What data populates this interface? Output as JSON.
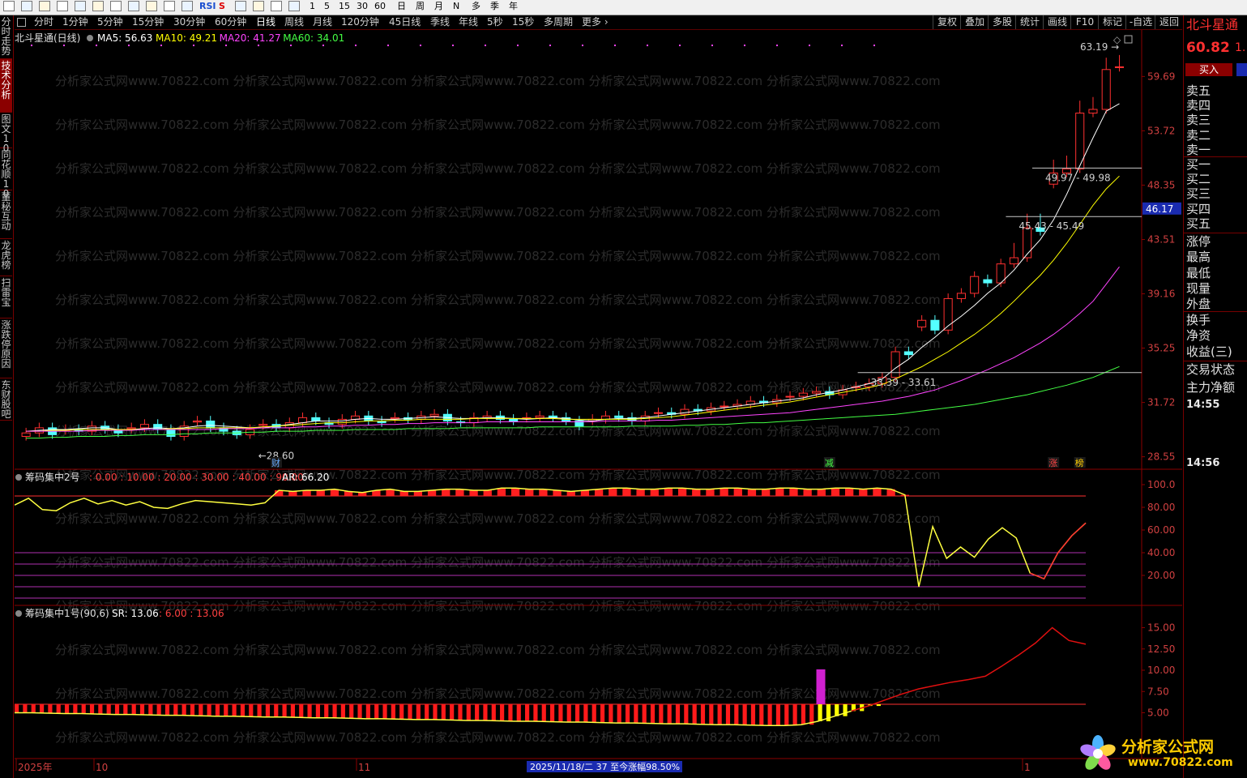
{
  "toolbar": {
    "icon_names": [
      "back-icon",
      "up-arrow-icon",
      "refresh-icon",
      "chart-icon",
      "table-icon",
      "line-chart-icon",
      "bar-chart-icon",
      "f10-icon",
      "f2-icon",
      "f3-icon",
      "circle-icon",
      "rsi-icon",
      "s-icon",
      "move-icon",
      "pen-icon",
      "f5-icon",
      "refresh2-icon"
    ],
    "rsi": "RSI",
    "s": "S",
    "minutes": [
      "1",
      "5",
      "15",
      "30",
      "60"
    ],
    "periods": [
      "日",
      "周",
      "月",
      "N",
      "多",
      "季",
      "年"
    ]
  },
  "period_bar": {
    "items": [
      "分时",
      "1分钟",
      "5分钟",
      "15分钟",
      "30分钟",
      "60分钟",
      "日线",
      "周线",
      "月线",
      "120分钟",
      "45日线",
      "季线",
      "年线",
      "5秒",
      "15秒",
      "多周期",
      "更多"
    ],
    "active": "日线",
    "right_buttons": [
      "复权",
      "叠加",
      "多股",
      "统计",
      "画线",
      "F10",
      "标记",
      "-自选",
      "返回"
    ]
  },
  "left_tabs": [
    {
      "label": "分时走势",
      "active": false
    },
    {
      "label": "技术分析",
      "active": true
    },
    {
      "label": "图文10",
      "active": false
    },
    {
      "label": "同花顺10",
      "active": false
    },
    {
      "label": "董秘互动",
      "active": false
    },
    {
      "label": "龙虎榜",
      "active": false
    },
    {
      "label": "扫雷宝",
      "active": false
    },
    {
      "label": "涨跌停原因",
      "active": false
    },
    {
      "label": "东财股吧",
      "active": false
    }
  ],
  "main_panel": {
    "title": "北斗星通(日线)",
    "ma": [
      {
        "label": "MA5: 56.63",
        "color": "#ffffff"
      },
      {
        "label": "MA10: 49.21",
        "color": "#ffff00"
      },
      {
        "label": "MA20: 41.27",
        "color": "#ff44ff"
      },
      {
        "label": "MA60: 34.01",
        "color": "#44ff44"
      }
    ],
    "price_axis": [
      "59.69",
      "53.72",
      "48.35",
      "43.51",
      "39.16",
      "35.25",
      "31.72",
      "28.55"
    ],
    "high_label": "63.19",
    "low_label": "←28.60",
    "current_price_tag": "46.17",
    "range_labels": [
      "49.97 - 49.98",
      "45.43 - 45.49",
      "33.39 - 33.61"
    ],
    "event_markers": [
      {
        "text": "财",
        "color": "#66aaff"
      },
      {
        "text": "减",
        "color": "#44ff44"
      },
      {
        "text": "涨",
        "color": "#ff4444"
      },
      {
        "text": "榜",
        "color": "#ffcc00"
      }
    ]
  },
  "ind2": {
    "title": "筹码集中2号",
    "levels_label": ": 0.00 : 10.00 : 20.00 : 30.00 : 40.00 : 90.00",
    "ar": "AR: 66.20",
    "axis": [
      "100.0",
      "80.00",
      "60.00",
      "40.00",
      "20.00"
    ]
  },
  "ind1": {
    "title": "筹码集中1号(90,6)",
    "sr": "SR: 13.06",
    "extra": ": 6.00 : 13.06",
    "axis": [
      "15.00",
      "12.50",
      "10.00",
      "7.50",
      "5.00"
    ]
  },
  "date_axis": {
    "labels": [
      "2025年",
      "10",
      "11",
      "1"
    ],
    "cursor_info": "2025/11/18/二 37 至今涨幅98.50%"
  },
  "right_panel": {
    "stock_name": "北斗星通",
    "price": "60.82",
    "price_suffix": "1.",
    "buy_button": "买入",
    "levels": [
      "卖五",
      "卖四",
      "卖三",
      "卖二",
      "卖一",
      "买一",
      "买二",
      "买三",
      "买四",
      "买五"
    ],
    "stats": [
      "涨停",
      "最高",
      "最低",
      "现量",
      "外盘",
      "换手",
      "净资",
      "收益(三)"
    ],
    "trade_status": "交易状态",
    "main_flow": "主力净额",
    "times": [
      "14:55",
      "14:56"
    ]
  },
  "watermark": {
    "brand": "分析家公式网",
    "url": "www.70822.com"
  },
  "chart_data": {
    "type": "candlestick",
    "series": [
      {
        "name": "main",
        "values": [
          29.9,
          30.2,
          29.8,
          30.1,
          30.0,
          30.3,
          30.1,
          29.9,
          30.2,
          30.4,
          30.1,
          29.7,
          30.3,
          30.6,
          30.2,
          30.0,
          29.8,
          30.1,
          30.4,
          30.2,
          30.5,
          30.8,
          30.6,
          30.4,
          30.7,
          30.9,
          30.6,
          30.5,
          30.8,
          30.7,
          30.9,
          31.0,
          30.6,
          30.5,
          30.8,
          30.9,
          30.7,
          30.6,
          30.8,
          30.9,
          30.8,
          30.6,
          30.3,
          30.7,
          30.9,
          30.8,
          30.6,
          30.9,
          31.1,
          31.0,
          31.3,
          31.2,
          31.4,
          31.5,
          31.6,
          31.8,
          31.7,
          31.9,
          32.1,
          32.3,
          32.4,
          32.2,
          32.5,
          32.7,
          32.9,
          33.3,
          35.0,
          34.8,
          37.2,
          36.5,
          38.8,
          39.2,
          40.5,
          40.0,
          41.5,
          42.0,
          44.5,
          44.2,
          49.5,
          49.9,
          55.6,
          56.0,
          60.5,
          60.82
        ]
      },
      {
        "name": "MA5",
        "values": [
          30.0,
          30.05,
          30.1,
          30.1,
          30.15,
          30.2,
          30.2,
          30.1,
          30.1,
          30.15,
          30.2,
          30.15,
          30.2,
          30.3,
          30.35,
          30.3,
          30.25,
          30.2,
          30.2,
          30.3,
          30.4,
          30.5,
          30.6,
          30.6,
          30.6,
          30.7,
          30.75,
          30.7,
          30.7,
          30.75,
          30.8,
          30.85,
          30.8,
          30.75,
          30.75,
          30.8,
          30.8,
          30.75,
          30.7,
          30.75,
          30.8,
          30.75,
          30.65,
          30.6,
          30.7,
          30.75,
          30.75,
          30.8,
          30.9,
          31.0,
          31.1,
          31.2,
          31.3,
          31.4,
          31.5,
          31.6,
          31.7,
          31.8,
          31.9,
          32.0,
          32.2,
          32.35,
          32.5,
          32.7,
          32.9,
          33.2,
          33.9,
          34.5,
          35.3,
          36.0,
          36.8,
          37.5,
          38.3,
          39.2,
          40.0,
          41.0,
          42.3,
          43.5,
          45.2,
          47.5,
          50.2,
          53.0,
          55.8,
          56.63
        ]
      },
      {
        "name": "MA10",
        "values": [
          30.0,
          30.0,
          30.05,
          30.05,
          30.1,
          30.1,
          30.1,
          30.1,
          30.1,
          30.1,
          30.1,
          30.15,
          30.15,
          30.2,
          30.2,
          30.2,
          30.2,
          30.2,
          30.25,
          30.3,
          30.35,
          30.4,
          30.45,
          30.5,
          30.5,
          30.55,
          30.6,
          30.6,
          30.65,
          30.65,
          30.7,
          30.7,
          30.7,
          30.7,
          30.75,
          30.75,
          30.75,
          30.75,
          30.75,
          30.75,
          30.75,
          30.7,
          30.7,
          30.7,
          30.7,
          30.7,
          30.7,
          30.75,
          30.8,
          30.85,
          30.95,
          31.05,
          31.15,
          31.25,
          31.35,
          31.45,
          31.55,
          31.65,
          31.75,
          31.9,
          32.05,
          32.2,
          32.35,
          32.5,
          32.65,
          32.85,
          33.2,
          33.6,
          34.0,
          34.5,
          35.0,
          35.6,
          36.2,
          36.9,
          37.7,
          38.6,
          39.6,
          40.6,
          41.8,
          43.2,
          44.8,
          46.5,
          48.0,
          49.21
        ]
      },
      {
        "name": "MA20",
        "values": [
          30.0,
          30.0,
          30.0,
          30.0,
          30.0,
          30.05,
          30.05,
          30.05,
          30.05,
          30.1,
          30.1,
          30.1,
          30.1,
          30.1,
          30.1,
          30.15,
          30.15,
          30.15,
          30.2,
          30.2,
          30.2,
          30.25,
          30.25,
          30.3,
          30.3,
          30.35,
          30.35,
          30.4,
          30.4,
          30.45,
          30.45,
          30.5,
          30.5,
          30.5,
          30.5,
          30.55,
          30.55,
          30.55,
          30.55,
          30.55,
          30.55,
          30.55,
          30.55,
          30.55,
          30.6,
          30.6,
          30.6,
          30.6,
          30.65,
          30.65,
          30.7,
          30.75,
          30.8,
          30.85,
          30.9,
          30.95,
          31.0,
          31.05,
          31.1,
          31.2,
          31.3,
          31.4,
          31.5,
          31.6,
          31.7,
          31.8,
          31.95,
          32.1,
          32.3,
          32.5,
          32.8,
          33.1,
          33.45,
          33.8,
          34.2,
          34.6,
          35.1,
          35.6,
          36.2,
          36.9,
          37.7,
          38.6,
          39.9,
          41.27
        ]
      },
      {
        "name": "MA60",
        "values": [
          29.6,
          29.6,
          29.65,
          29.65,
          29.7,
          29.7,
          29.7,
          29.75,
          29.75,
          29.8,
          29.8,
          29.8,
          29.85,
          29.85,
          29.9,
          29.9,
          29.9,
          29.95,
          29.95,
          30.0,
          30.0,
          30.0,
          30.05,
          30.05,
          30.05,
          30.1,
          30.1,
          30.1,
          30.1,
          30.15,
          30.15,
          30.15,
          30.15,
          30.2,
          30.2,
          30.2,
          30.2,
          30.2,
          30.2,
          30.25,
          30.25,
          30.25,
          30.25,
          30.25,
          30.25,
          30.25,
          30.3,
          30.3,
          30.3,
          30.3,
          30.35,
          30.35,
          30.4,
          30.4,
          30.45,
          30.5,
          30.5,
          30.55,
          30.6,
          30.65,
          30.7,
          30.75,
          30.8,
          30.85,
          30.9,
          30.95,
          31.0,
          31.1,
          31.2,
          31.3,
          31.4,
          31.5,
          31.6,
          31.75,
          31.9,
          32.05,
          32.2,
          32.4,
          32.6,
          32.8,
          33.05,
          33.3,
          33.65,
          34.01
        ]
      }
    ],
    "ind2_values": [
      82,
      88,
      78,
      77,
      84,
      88,
      83,
      86,
      82,
      85,
      80,
      79,
      83,
      86,
      85,
      84,
      83,
      82,
      84,
      95,
      94,
      95,
      95,
      96,
      94,
      93,
      95,
      96,
      94,
      94,
      95,
      96,
      96,
      95,
      95,
      97,
      97,
      96,
      96,
      95,
      94,
      95,
      96,
      97,
      97,
      96,
      96,
      97,
      97,
      96,
      96,
      97,
      97,
      96,
      96,
      97,
      97,
      96,
      96,
      97,
      97,
      96,
      97,
      96,
      91,
      10,
      63,
      35,
      45,
      36,
      52,
      62,
      53,
      22,
      17,
      40,
      55,
      66.2
    ],
    "ind1_values": [
      5.0,
      5.0,
      4.95,
      4.9,
      4.9,
      4.85,
      4.8,
      4.8,
      4.75,
      4.7,
      4.7,
      4.65,
      4.6,
      4.6,
      4.55,
      4.5,
      4.5,
      4.45,
      4.4,
      4.4,
      4.35,
      4.3,
      4.3,
      4.25,
      4.2,
      4.2,
      4.15,
      4.1,
      4.1,
      4.05,
      4.0,
      4.0,
      3.95,
      3.9,
      3.9,
      3.85,
      3.8,
      3.8,
      3.75,
      3.7,
      3.7,
      3.65,
      3.6,
      3.6,
      3.55,
      3.5,
      3.5,
      3.6,
      4.0,
      4.6,
      5.2,
      5.8,
      6.5,
      7.2,
      7.8,
      8.2,
      8.6,
      8.9,
      9.3,
      10.5,
      11.8,
      13.2,
      15.0,
      13.5,
      13.06
    ],
    "ylim_main": [
      28.0,
      63.5
    ],
    "ylim_ind2": [
      0,
      100
    ],
    "ylim_ind1": [
      0,
      16
    ]
  }
}
